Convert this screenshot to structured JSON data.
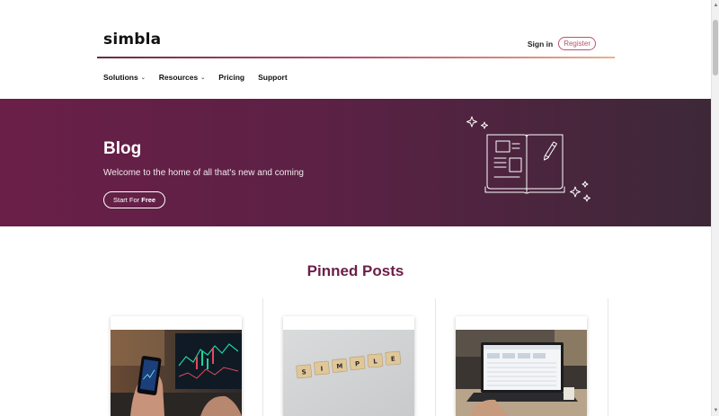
{
  "header": {
    "logo_text": "simbla",
    "sign_in": "Sign in",
    "register": "Register"
  },
  "nav": {
    "items": [
      {
        "label": "Solutions",
        "has_dropdown": true
      },
      {
        "label": "Resources",
        "has_dropdown": true
      },
      {
        "label": "Pricing",
        "has_dropdown": false
      },
      {
        "label": "Support",
        "has_dropdown": false
      }
    ],
    "caret": "⌄"
  },
  "hero": {
    "title": "Blog",
    "subtitle": "Welcome to the home of all that's new and coming",
    "button_prefix": "Start For ",
    "button_bold": "Free"
  },
  "pinned": {
    "title": "Pinned Posts",
    "cards": [
      {
        "image": "person-holding-phone-with-trading-charts"
      },
      {
        "image": "wooden-tiles-spelling-simple",
        "tiles": [
          "S",
          "I",
          "M",
          "P",
          "L",
          "E"
        ]
      },
      {
        "image": "laptop-with-dashboard-on-desk"
      }
    ]
  },
  "colors": {
    "brand": "#6a1f48",
    "hero_start": "#6a1f48",
    "hero_end": "#3d2838",
    "register": "#c0506d"
  }
}
